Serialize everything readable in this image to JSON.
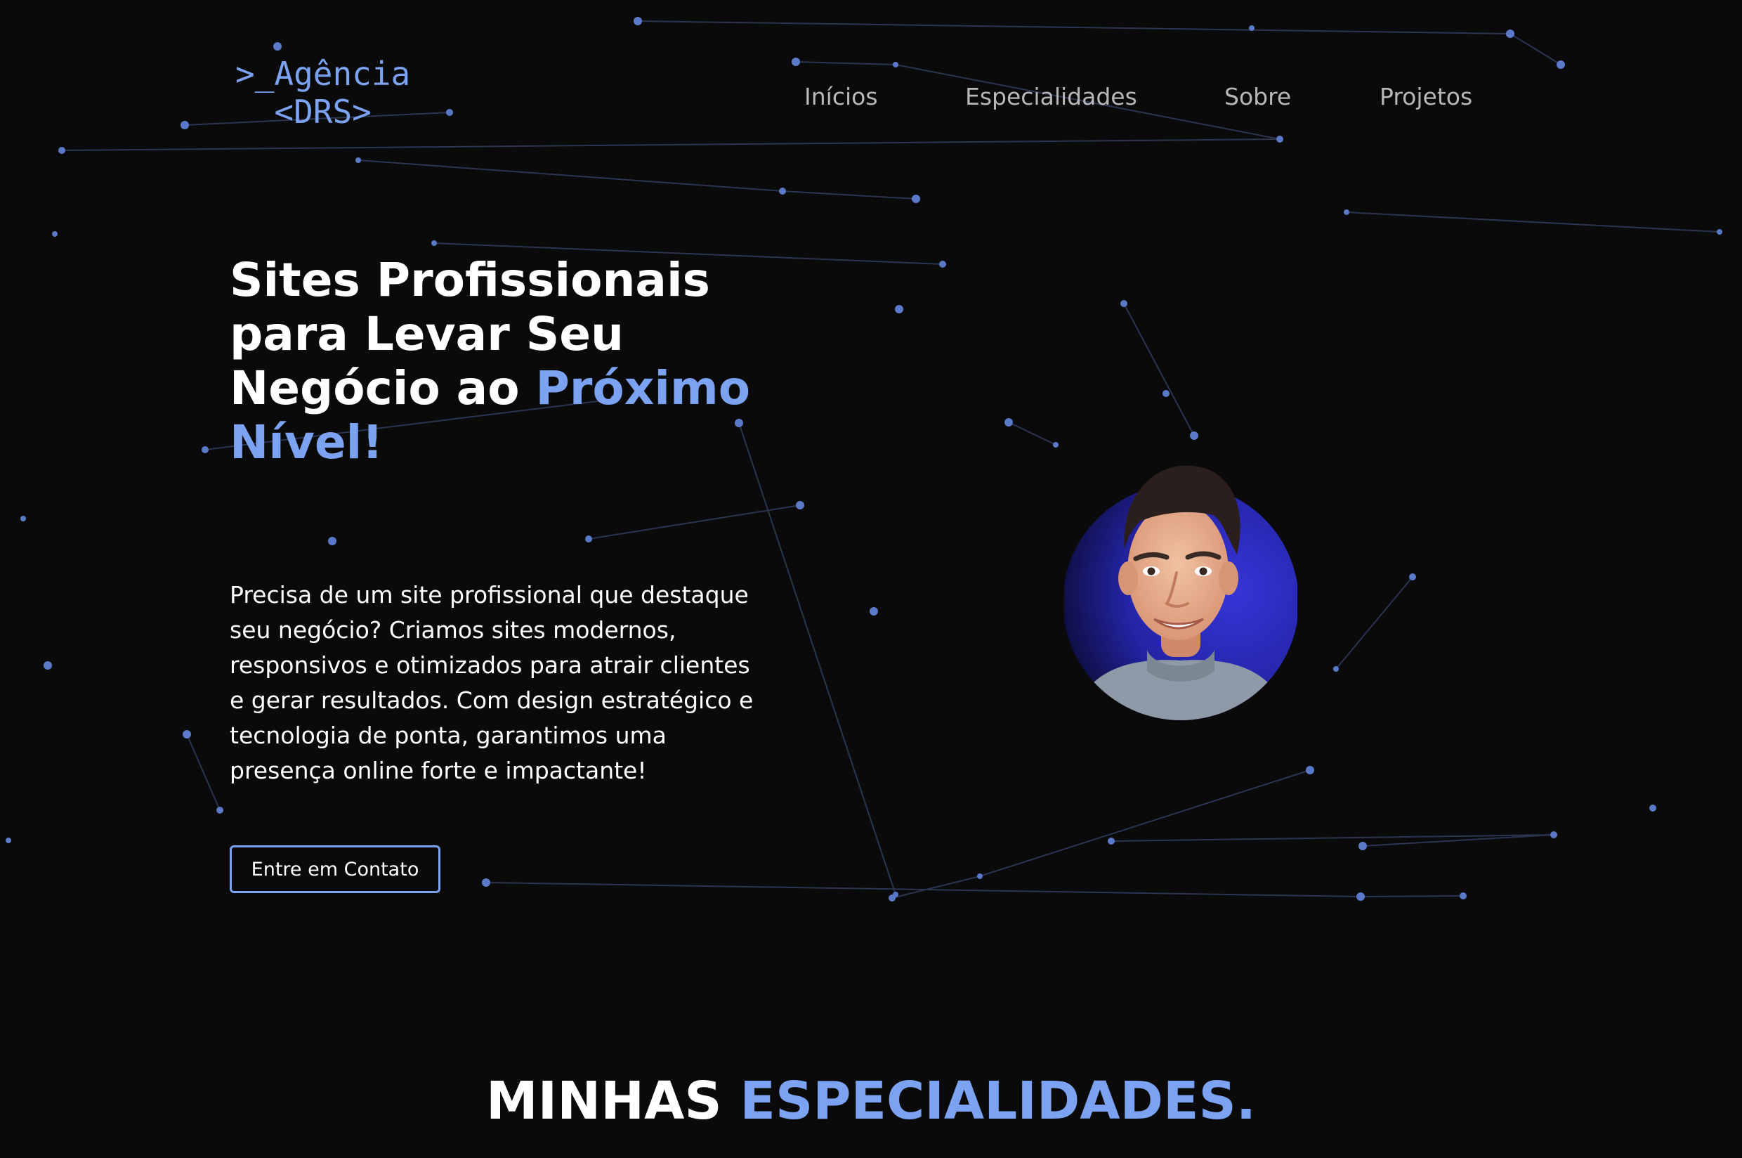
{
  "header": {
    "logo_line1": ">_Agência",
    "logo_line2": "<DRS>"
  },
  "nav": {
    "items": [
      "Inícios",
      "Especialidades",
      "Sobre",
      "Projetos"
    ]
  },
  "hero": {
    "title_white": "Sites Profissionais para Levar Seu Negócio ao ",
    "title_accent": "Próximo Nível!",
    "description": "Precisa de um site profissional que destaque seu negócio? Criamos sites modernos, responsivos e otimizados para atrair clientes e gerar resultados. Com design estratégico e tecnologia de ponta, garantimos uma presença online forte e impactante!",
    "cta_label": "Entre em Contato"
  },
  "specialties": {
    "title_white": "MINHAS ",
    "title_accent": "ESPECIALIDADES."
  },
  "colors": {
    "background": "#0a0a0b",
    "accent": "#7ba3f2",
    "avatar_circle": "#2f2fc8",
    "nav_text": "#b8b8bc",
    "particles": "#5b79c9"
  },
  "icons": {
    "avatar": "profile-photo"
  }
}
